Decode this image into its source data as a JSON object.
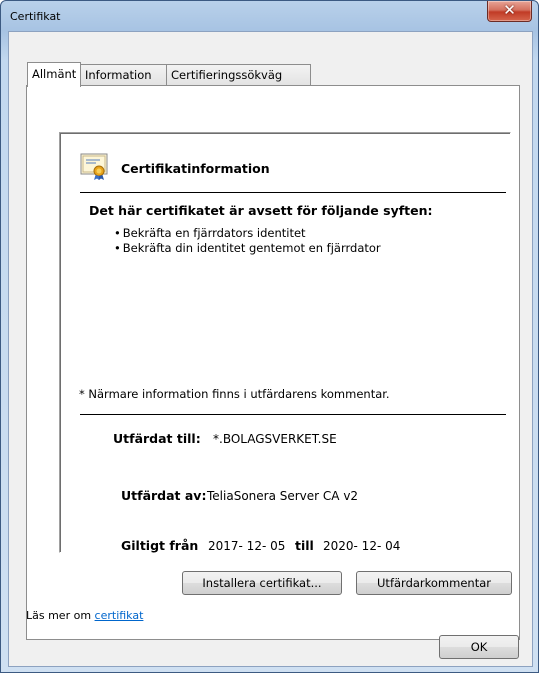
{
  "window": {
    "title": "Certifikat"
  },
  "tabs": [
    {
      "label": "Allmänt",
      "active": true
    },
    {
      "label": "Information",
      "active": false
    },
    {
      "label": "Certifieringssökväg",
      "active": false
    }
  ],
  "cert": {
    "heading": "Certifikatinformation",
    "purpose_heading": "Det här certifikatet är avsett för följande syften:",
    "purposes": [
      "Bekräfta en fjärrdators identitet",
      "Bekräfta din identitet gentemot en fjärrdator"
    ],
    "note": "* Närmare information finns i utfärdarens kommentar.",
    "issued_to_label": "Utfärdat till:",
    "issued_to_value": "*.BOLAGSVERKET.SE",
    "issued_by_label": "Utfärdat av:",
    "issued_by_value": "TeliaSonera Server CA v2",
    "valid_from_label": "Giltigt från",
    "valid_from_value": "2017- 12- 05",
    "valid_to_label": "till",
    "valid_to_value": "2020- 12- 04"
  },
  "buttons": {
    "install": "Installera certifikat...",
    "issuer_statement": "Utfärdarkommentar",
    "ok": "OK"
  },
  "footer": {
    "learn_prefix": "Läs mer om ",
    "learn_link": "certifikat"
  },
  "colors": {
    "link": "#0066cc",
    "titlebar": "#b9d1ea",
    "close_button": "#c13b26"
  }
}
